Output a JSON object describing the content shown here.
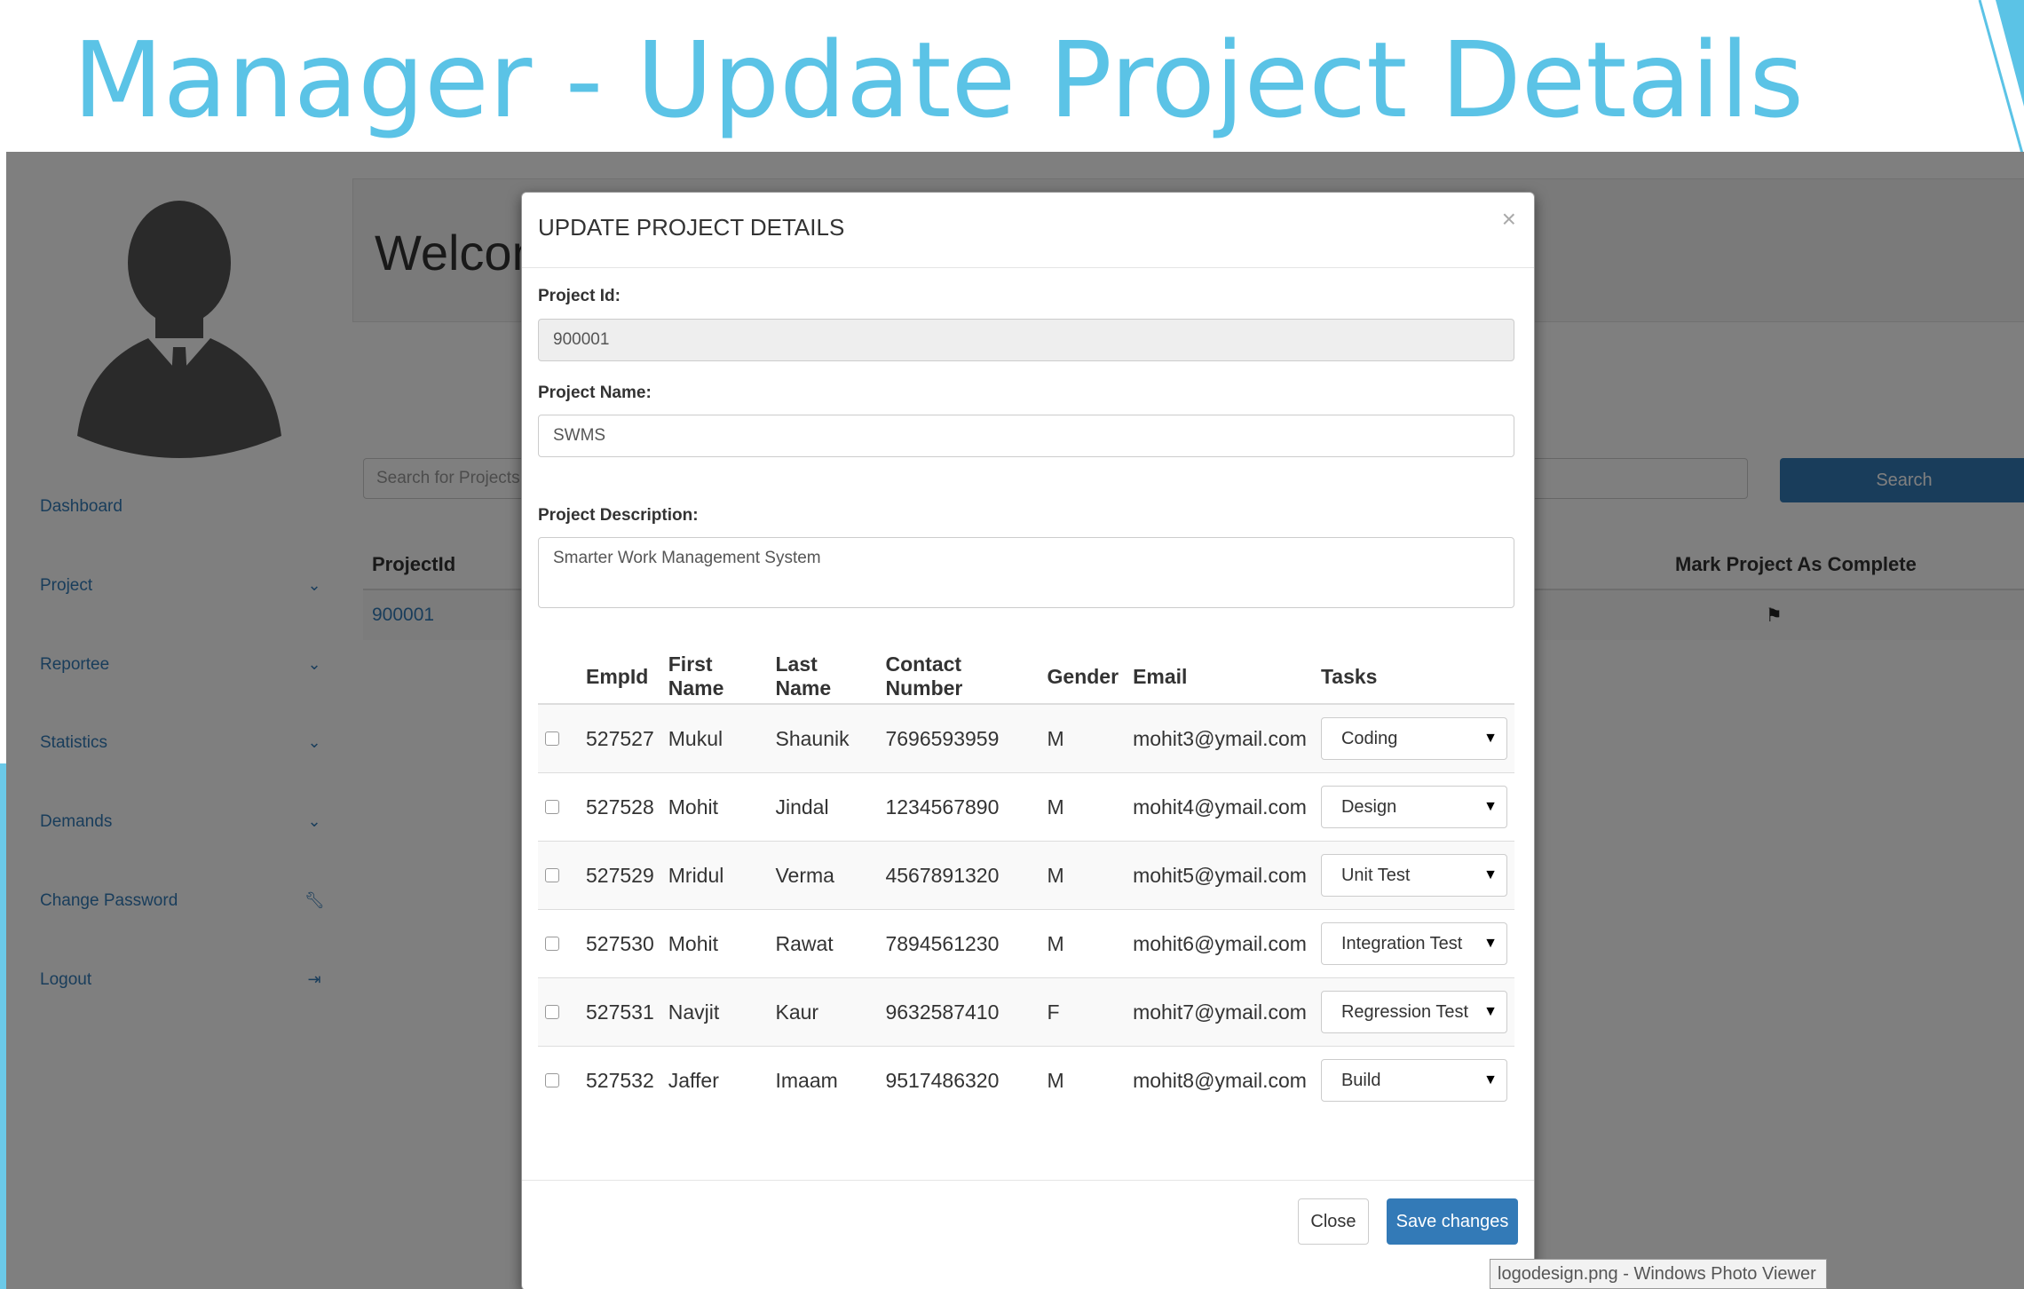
{
  "slide": {
    "title": "Manager - Update Project Details"
  },
  "sidebar": {
    "items": [
      {
        "label": "Dashboard",
        "icon": ""
      },
      {
        "label": "Project",
        "icon": "chevron-down-icon"
      },
      {
        "label": "Reportee",
        "icon": "chevron-down-icon"
      },
      {
        "label": "Statistics",
        "icon": "chevron-down-icon"
      },
      {
        "label": "Demands",
        "icon": "chevron-down-icon"
      },
      {
        "label": "Change Password",
        "icon": "wrench-icon"
      },
      {
        "label": "Logout",
        "icon": "logout-icon"
      }
    ]
  },
  "main": {
    "welcome": "Welcome",
    "search_placeholder": "Search for Projects",
    "search_button": "Search",
    "table": {
      "headers": [
        "ProjectId",
        "Mark Project As Complete"
      ],
      "rows": [
        {
          "project_id": "900001"
        }
      ]
    }
  },
  "modal": {
    "title": "UPDATE PROJECT DETAILS",
    "close_icon": "×",
    "project_id_label": "Project Id:",
    "project_id_value": "900001",
    "project_name_label": "Project Name:",
    "project_name_value": "SWMS",
    "project_desc_label": "Project Description:",
    "project_desc_value": "Smarter Work Management System",
    "columns": [
      "EmpId",
      "First Name",
      "Last Name",
      "Contact Number",
      "Gender",
      "Email",
      "Tasks"
    ],
    "rows": [
      {
        "emp_id": "527527",
        "first": "Mukul",
        "last": "Shaunik",
        "contact": "7696593959",
        "gender": "M",
        "email": "mohit3@ymail.com",
        "task": "Coding"
      },
      {
        "emp_id": "527528",
        "first": "Mohit",
        "last": "Jindal",
        "contact": "1234567890",
        "gender": "M",
        "email": "mohit4@ymail.com",
        "task": "Design"
      },
      {
        "emp_id": "527529",
        "first": "Mridul",
        "last": "Verma",
        "contact": "4567891320",
        "gender": "M",
        "email": "mohit5@ymail.com",
        "task": "Unit Test"
      },
      {
        "emp_id": "527530",
        "first": "Mohit",
        "last": "Rawat",
        "contact": "7894561230",
        "gender": "M",
        "email": "mohit6@ymail.com",
        "task": "Integration Test"
      },
      {
        "emp_id": "527531",
        "first": "Navjit",
        "last": "Kaur",
        "contact": "9632587410",
        "gender": "F",
        "email": "mohit7@ymail.com",
        "task": "Regression Test"
      },
      {
        "emp_id": "527532",
        "first": "Jaffer",
        "last": "Imaam",
        "contact": "9517486320",
        "gender": "M",
        "email": "mohit8@ymail.com",
        "task": "Build"
      }
    ],
    "close_button": "Close",
    "save_button": "Save changes"
  },
  "tooltip": "logodesign.png - Windows Photo Viewer",
  "colors": {
    "title": "#5bc3e6",
    "primary": "#337ab7"
  }
}
